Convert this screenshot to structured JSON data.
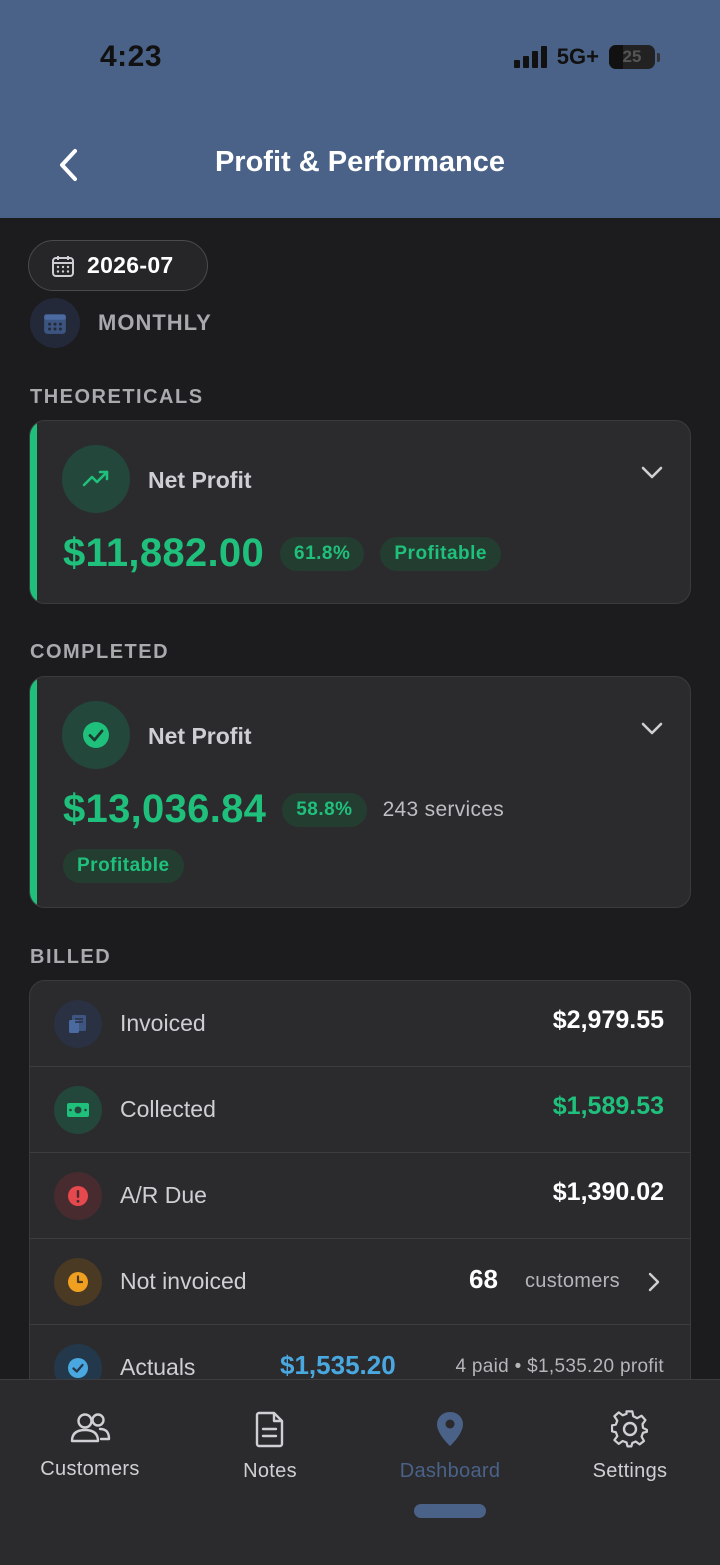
{
  "status": {
    "time": "4:23",
    "network": "5G+",
    "battery": "25"
  },
  "header": {
    "title": "Profit & Performance"
  },
  "filters": {
    "date": "2026-07",
    "period": "MONTHLY"
  },
  "sections": {
    "theoreticals": "THEORETICALS",
    "completed": "COMPLETED",
    "billed": "BILLED"
  },
  "theoreticals_card": {
    "label": "Net Profit",
    "amount": "$11,882.00",
    "margin": "61.8%",
    "status": "Profitable"
  },
  "completed_card": {
    "label": "Net Profit",
    "amount": "$13,036.84",
    "margin": "58.8%",
    "services": "243 services",
    "status": "Profitable"
  },
  "billed_rows": {
    "invoiced": {
      "label": "Invoiced",
      "value": "$2,979.55"
    },
    "collected": {
      "label": "Collected",
      "value": "$1,589.53"
    },
    "ar_due": {
      "label": "A/R Due",
      "value": "$1,390.02"
    },
    "not_invoiced": {
      "label": "Not invoiced",
      "count": "68",
      "unit": "customers"
    },
    "actuals": {
      "label": "Actuals",
      "value": "$1,535.20",
      "detail": "4 paid • $1,535.20 profit"
    }
  },
  "tabs": {
    "customers": "Customers",
    "notes": "Notes",
    "dashboard": "Dashboard",
    "settings": "Settings"
  },
  "colors": {
    "header": "#4a6287",
    "background": "#1c1c1e",
    "card": "#2b2b2e",
    "profit_green": "#1fc07c",
    "actuals_blue": "#4aa8e0",
    "warning_red": "#e5484d",
    "clock_orange": "#f0a020"
  },
  "icons": [
    "back-chevron-icon",
    "calendar-icon",
    "trending-up-icon",
    "check-circle-icon",
    "chevron-down-icon",
    "invoice-icon",
    "cash-icon",
    "alert-icon",
    "clock-icon",
    "chevron-right-icon",
    "people-icon",
    "document-icon",
    "map-pin-icon",
    "gear-icon"
  ]
}
